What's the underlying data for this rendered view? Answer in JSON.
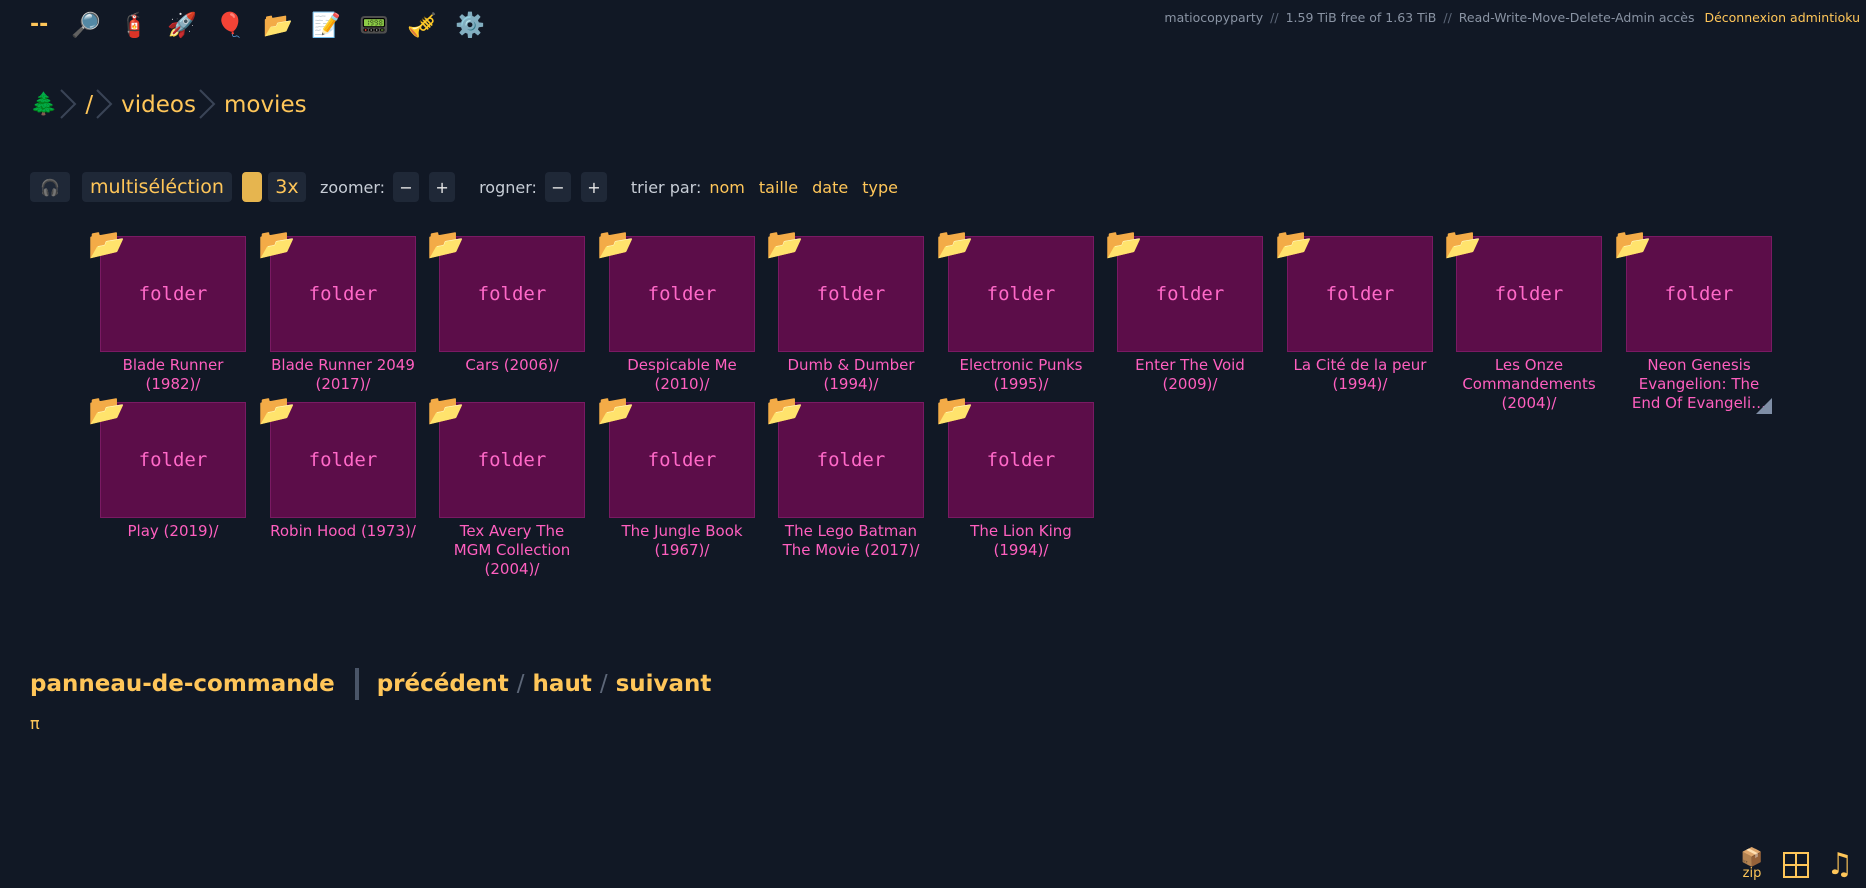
{
  "ops": [
    {
      "name": "collapse-ops-button",
      "glyph": "--"
    },
    {
      "name": "search-icon",
      "glyph": "🔎"
    },
    {
      "name": "unpost-icon",
      "glyph": "🧯"
    },
    {
      "name": "upload-icon",
      "glyph": "🚀"
    },
    {
      "name": "balloon-icon",
      "glyph": "🎈"
    },
    {
      "name": "new-folder-icon",
      "glyph": "📂"
    },
    {
      "name": "new-file-icon",
      "glyph": "📝"
    },
    {
      "name": "messages-icon",
      "glyph": "📟"
    },
    {
      "name": "trumpet-icon",
      "glyph": "🎺"
    },
    {
      "name": "settings-gear-icon",
      "glyph": "⚙️"
    }
  ],
  "account": {
    "server": "matiocopyparty",
    "sep": "//",
    "disk": "1.59 TiB free of 1.63 TiB",
    "perms": "Read-Write-Move-Delete-Admin accès",
    "logout": "Déconnexion admintioku"
  },
  "breadcrumb": {
    "tree_glyph": "🌲",
    "items": [
      "/",
      "videos",
      "movies"
    ]
  },
  "toolbar": {
    "audio_glyph": "🎧",
    "multiselect": "multiséléction",
    "thumbs_x": "3x",
    "zoom_label": "zoomer:",
    "crop_label": "rogner:",
    "minus": "−",
    "plus": "+",
    "sort_label": "trier par:",
    "sort": [
      "nom",
      "taille",
      "date",
      "type"
    ]
  },
  "thumb_label": "folder",
  "folder_glyph": "📂",
  "folders": [
    "Blade Runner (1982)/",
    "Blade Runner 2049 (2017)/",
    "Cars (2006)/",
    "Despicable Me (2010)/",
    "Dumb & Dumber (1994)/",
    "Electronic Punks (1995)/",
    "Enter The Void (2009)/",
    "La Cité de la peur (1994)/",
    "Les Onze Commandements (2004)/",
    "Neon Genesis Evangelion: The End Of Evangeli…",
    "Play (2019)/",
    "Robin Hood (1973)/",
    "Tex Avery The MGM Collection (2004)/",
    "The Jungle Book (1967)/",
    "The Lego Batman The Movie (2017)/",
    "The Lion King (1994)/"
  ],
  "footer": {
    "panel": "panneau-de-commande",
    "prev": "précédent",
    "up": "haut",
    "next": "suivant",
    "slash": "/",
    "pi": "π"
  },
  "corner": {
    "zip_glyph": "📦",
    "zip_label": "zip",
    "note_glyph": "♫"
  }
}
